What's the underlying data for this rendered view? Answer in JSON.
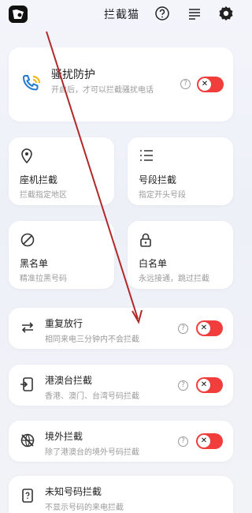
{
  "header": {
    "title": "拦截猫",
    "app_icon": "app-logo-icon",
    "help_icon": "help-circle-icon",
    "menu_icon": "menu-lines-icon",
    "settings_icon": "gear-icon"
  },
  "harassment": {
    "title": "骚扰防护",
    "subtitle": "开启后，才可以拦截骚扰电话",
    "icon": "phone-waves-icon",
    "enabled": false
  },
  "tiles": [
    {
      "title": "座机拦截",
      "subtitle": "拦截指定地区",
      "icon": "location-pin-icon"
    },
    {
      "title": "号段拦截",
      "subtitle": "指定开头号段",
      "icon": "list-icon"
    },
    {
      "title": "黑名单",
      "subtitle": "精准拉黑号码",
      "icon": "block-circle-icon"
    },
    {
      "title": "白名单",
      "subtitle": "永远接通，跳过拦截",
      "icon": "lock-icon"
    }
  ],
  "rows": [
    {
      "title": "重复放行",
      "subtitle": "相同来电三分钟内不会拦截",
      "icon": "swap-arrows-icon",
      "enabled": false
    },
    {
      "title": "港澳台拦截",
      "subtitle": "香港、澳门、台湾号码拦截",
      "icon": "phone-exit-icon",
      "enabled": false
    },
    {
      "title": "境外拦截",
      "subtitle": "除了港澳台的境外号码拦截",
      "icon": "globe-off-icon",
      "enabled": false
    },
    {
      "title": "未知号码拦截",
      "subtitle": "不显示号码的来电拦截",
      "icon": "phone-question-icon"
    }
  ],
  "toggle_glyph": "✕",
  "help_glyph": "?",
  "colors": {
    "toggle_on_bg": "#f23d3d",
    "arrow": "#b0282a"
  }
}
